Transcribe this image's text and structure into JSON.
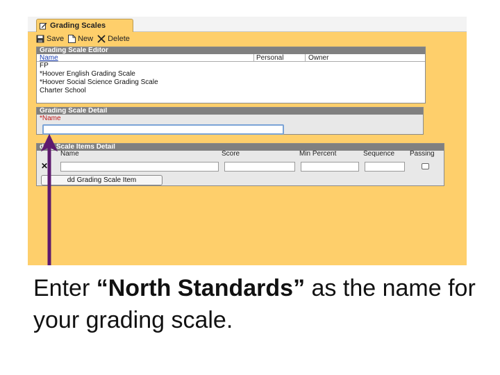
{
  "tab": {
    "title": "Grading Scales",
    "icon": "edit-icon"
  },
  "toolbar": {
    "save_label": "Save",
    "new_label": "New",
    "delete_label": "Delete"
  },
  "editor": {
    "title": "Grading Scale Editor",
    "columns": {
      "name": "Name",
      "personal": "Personal",
      "owner": "Owner"
    },
    "items": [
      "FP",
      "*Hoover English Grading Scale",
      "*Hoover Social Science Grading Scale",
      "Charter School"
    ]
  },
  "detail": {
    "title": "Grading Scale Detail",
    "name_label": "*Name",
    "name_value": ""
  },
  "items_detail": {
    "title": "ding Scale Items Detail",
    "columns": {
      "name": "Name",
      "score": "Score",
      "min_percent": "Min Percent",
      "sequence": "Sequence",
      "passing": "Passing"
    },
    "add_button": "dd Grading Scale Item"
  },
  "caption": {
    "prefix": "Enter ",
    "emphasis": "“North Standards”",
    "suffix": " as the name for your grading scale."
  },
  "colors": {
    "arrow": "#5e1a6e",
    "background": "#fecf6b",
    "accent_border": "#7aa3d6"
  }
}
